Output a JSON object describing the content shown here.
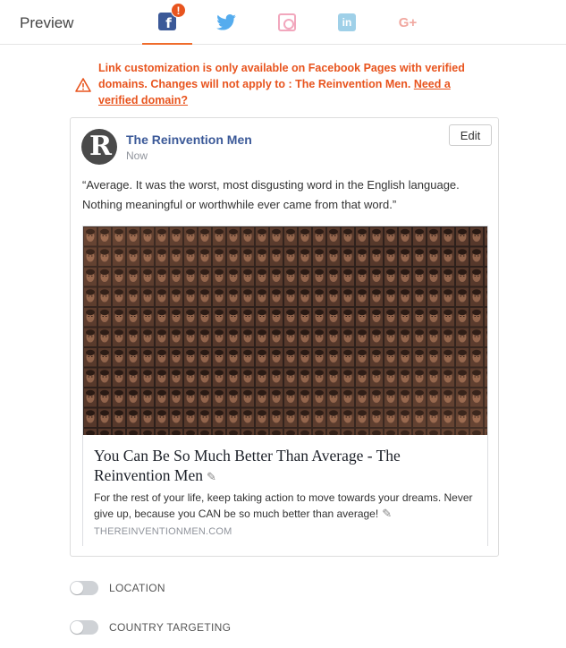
{
  "header": {
    "title": "Preview",
    "tabs": [
      {
        "name": "facebook",
        "icon": "facebook-icon",
        "active": true,
        "badge": "!"
      },
      {
        "name": "twitter",
        "icon": "twitter-icon",
        "active": false
      },
      {
        "name": "instagram",
        "icon": "instagram-icon",
        "active": false
      },
      {
        "name": "linkedin",
        "icon": "linkedin-icon",
        "active": false
      },
      {
        "name": "google-plus",
        "icon": "google-plus-icon",
        "active": false
      }
    ],
    "fb_glyph": "f",
    "li_glyph": "in",
    "gp_glyph": "G+"
  },
  "warning": {
    "text": "Link customization is only available on Facebook Pages with verified domains. Changes will not apply to : The Reinvention Men. ",
    "link": "Need a verified domain?"
  },
  "post": {
    "page_name": "The Reinvention Men",
    "time": "Now",
    "edit_label": "Edit",
    "text": "“Average. It was the worst, most disgusting word in the English language. Nothing meaningful or worthwhile ever came from that word.”",
    "avatar_glyph": "R"
  },
  "link_preview": {
    "title": "You Can Be So Much Better Than Average - The Reinvention Men",
    "description": "For the rest of your life, keep taking action to move towards your dreams. Never give up, because you CAN be so much better than average!",
    "domain": "THEREINVENTIONMEN.COM"
  },
  "toggles": [
    {
      "label": "LOCATION",
      "on": false
    },
    {
      "label": "COUNTRY TARGETING",
      "on": false
    }
  ],
  "colors": {
    "accent": "#e8541e",
    "facebook": "#3b5998",
    "twitter": "#55acee"
  }
}
